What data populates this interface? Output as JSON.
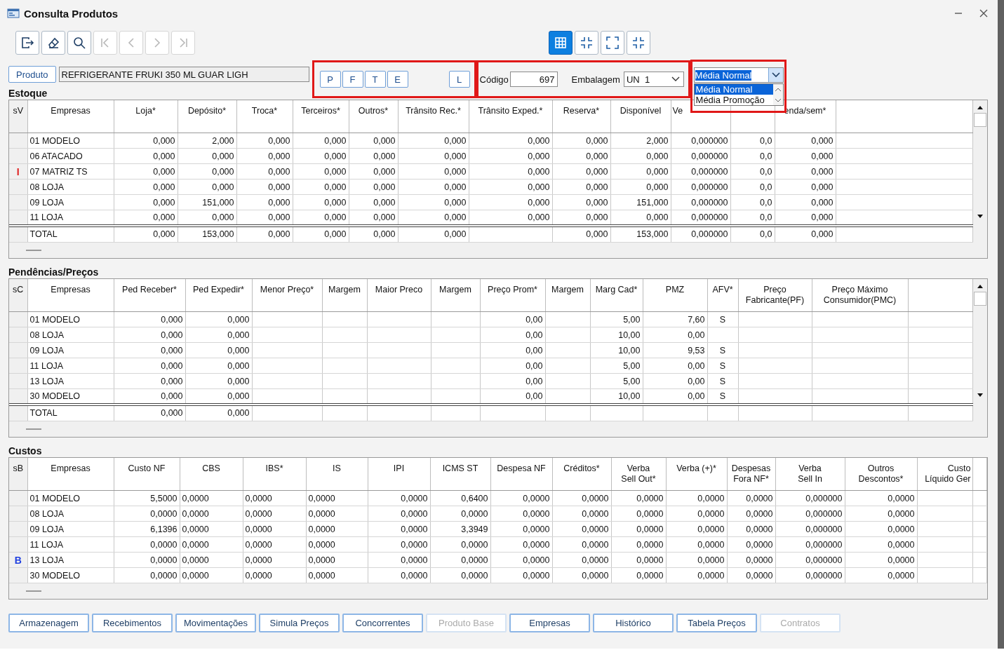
{
  "window": {
    "title": "Consulta Produtos"
  },
  "toolbar": [
    {
      "kind": "exit",
      "disabled": false
    },
    {
      "kind": "eraser",
      "disabled": false
    },
    {
      "kind": "search",
      "disabled": false
    },
    {
      "kind": "first",
      "disabled": true
    },
    {
      "kind": "prev",
      "disabled": true
    },
    {
      "kind": "next",
      "disabled": true
    },
    {
      "kind": "last",
      "disabled": true
    }
  ],
  "view_buttons": [
    {
      "kind": "grid",
      "selected": true
    },
    {
      "kind": "shrink",
      "selected": false
    },
    {
      "kind": "expand",
      "selected": false
    },
    {
      "kind": "shrink",
      "selected": false
    }
  ],
  "product": {
    "button": "Produto",
    "value": "REFRIGERANTE FRUKI 350 ML GUAR LIGH"
  },
  "filters": [
    {
      "label": "P"
    },
    {
      "label": "F"
    },
    {
      "label": "T"
    },
    {
      "label": "E"
    }
  ],
  "filter_extra": "L",
  "code": {
    "label": "Código",
    "value": "697"
  },
  "packaging": {
    "label": "Embalagem",
    "value": "UN  1"
  },
  "average": {
    "value": "Média Normal",
    "expanded": true,
    "options": [
      {
        "label": "Média Normal",
        "selected": true
      },
      {
        "label": "Média Promoção",
        "selected": false
      }
    ]
  },
  "tables": [
    {
      "title": "Estoque",
      "marker_header": "sV",
      "columns": [
        "Empresas",
        "Loja*",
        "Depósito*",
        "Troca*",
        "Terceiros*",
        "Outros*",
        "Trânsito Rec.*",
        "Trânsito Exped.*",
        "Reserva*",
        "Disponível",
        "Ve",
        "",
        "enda/sem*"
      ],
      "rows": [
        {
          "cells": [
            "01 MODELO",
            "0,000",
            "2,000",
            "0,000",
            "0,000",
            "0,000",
            "0,000",
            "0,000",
            "0,000",
            "2,000",
            "0,000000",
            "0,0",
            "0,000"
          ]
        },
        {
          "cells": [
            "06 ATACADO",
            "0,000",
            "0,000",
            "0,000",
            "0,000",
            "0,000",
            "0,000",
            "0,000",
            "0,000",
            "0,000",
            "0,000000",
            "0,0",
            "0,000"
          ]
        },
        {
          "marker": {
            "text": "I",
            "color": "#e02020"
          },
          "cells": [
            "07 MATRIZ TS",
            "0,000",
            "0,000",
            "0,000",
            "0,000",
            "0,000",
            "0,000",
            "0,000",
            "0,000",
            "0,000",
            "0,000000",
            "0,0",
            "0,000"
          ]
        },
        {
          "cells": [
            "08 LOJA",
            "0,000",
            "0,000",
            "0,000",
            "0,000",
            "0,000",
            "0,000",
            "0,000",
            "0,000",
            "0,000",
            "0,000000",
            "0,0",
            "0,000"
          ]
        },
        {
          "cells": [
            "09 LOJA",
            "0,000",
            "151,000",
            "0,000",
            "0,000",
            "0,000",
            "0,000",
            "0,000",
            "0,000",
            "151,000",
            "0,000000",
            "0,0",
            "0,000"
          ]
        },
        {
          "cells": [
            "11 LOJA",
            "0,000",
            "0,000",
            "0,000",
            "0,000",
            "0,000",
            "0,000",
            "0,000",
            "0,000",
            "0,000",
            "0,000000",
            "0,0",
            "0,000"
          ]
        }
      ],
      "total": [
        "TOTAL",
        "0,000",
        "153,000",
        "0,000",
        "0,000",
        "0,000",
        "0,000",
        {
          "empty": true
        },
        "0,000",
        "153,000",
        "0,000000",
        "0,0",
        "0,000"
      ],
      "scrollbar": true
    },
    {
      "title": "Pendências/Preços",
      "marker_header": "sC",
      "columns": [
        "Empresas",
        "Ped Receber*",
        "Ped Expedir*",
        "Menor Preço*",
        "Margem",
        "Maior Preco",
        "Margem",
        "Preço Prom*",
        "Margem",
        "Marg Cad*",
        "PMZ",
        "AFV*",
        "Preço\nFabricante(PF)",
        "Preço Máximo\nConsumidor(PMC)"
      ],
      "rows": [
        {
          "cells": [
            "01 MODELO",
            "0,000",
            "0,000",
            "",
            "",
            "",
            "",
            "0,00",
            "",
            "5,00",
            "7,60",
            "S"
          ]
        },
        {
          "cells": [
            "08 LOJA",
            "0,000",
            "0,000",
            "",
            "",
            "",
            "",
            "0,00",
            "",
            "10,00",
            "0,00"
          ]
        },
        {
          "cells": [
            "09 LOJA",
            "0,000",
            "0,000",
            "",
            "",
            "",
            "",
            "0,00",
            "",
            "10,00",
            "9,53",
            "S"
          ]
        },
        {
          "cells": [
            "11 LOJA",
            "0,000",
            "0,000",
            "",
            "",
            "",
            "",
            "0,00",
            "",
            "5,00",
            "0,00",
            "S"
          ]
        },
        {
          "cells": [
            "13 LOJA",
            "0,000",
            "0,000",
            "",
            "",
            "",
            "",
            "0,00",
            "",
            "5,00",
            "0,00",
            "S"
          ]
        },
        {
          "cells": [
            "30 MODELO",
            "0,000",
            "0,000",
            "",
            "",
            "",
            "",
            "0,00",
            "",
            "10,00",
            "0,00",
            "S"
          ]
        }
      ],
      "total": [
        "TOTAL",
        "0,000",
        "0,000"
      ],
      "scrollbar": true
    },
    {
      "title": "Custos",
      "marker_header": "sB",
      "columns": [
        "Empresas",
        "Custo NF",
        "CBS",
        "IBS*",
        "IS",
        "IPI",
        "ICMS ST",
        "Despesa NF",
        "Créditos*",
        "Verba\nSell Out*",
        "Verba (+)*",
        "Despesas\nFora NF*",
        "Verba\nSell In",
        "Outros\nDescontos*",
        "Custo\nLíquido Ger"
      ],
      "rows": [
        {
          "cells": [
            "01 MODELO",
            "5,5000",
            "0,0000",
            "0,0000",
            "0,0000",
            "0,0000",
            "0,6400",
            "0,0000",
            "0,0000",
            "0,0000",
            "0,0000",
            "0,0000",
            "0,000000",
            "0,0000"
          ]
        },
        {
          "cells": [
            "08 LOJA",
            "0,0000",
            "0,0000",
            "0,0000",
            "0,0000",
            "0,0000",
            "0,0000",
            "0,0000",
            "0,0000",
            "0,0000",
            "0,0000",
            "0,0000",
            "0,000000",
            "0,0000"
          ]
        },
        {
          "cells": [
            "09 LOJA",
            "6,1396",
            "0,0000",
            "0,0000",
            "0,0000",
            "0,0000",
            "3,3949",
            "0,0000",
            "0,0000",
            "0,0000",
            "0,0000",
            "0,0000",
            "0,000000",
            "0,0000"
          ]
        },
        {
          "cells": [
            "11 LOJA",
            "0,0000",
            "0,0000",
            "0,0000",
            "0,0000",
            "0,0000",
            "0,0000",
            "0,0000",
            "0,0000",
            "0,0000",
            "0,0000",
            "0,0000",
            "0,000000",
            "0,0000"
          ]
        },
        {
          "marker": {
            "text": "B",
            "color": "#2040e0"
          },
          "cells": [
            "13 LOJA",
            "0,0000",
            "0,0000",
            "0,0000",
            "0,0000",
            "0,0000",
            "0,0000",
            "0,0000",
            "0,0000",
            "0,0000",
            "0,0000",
            "0,0000",
            "0,000000",
            "0,0000"
          ]
        },
        {
          "cells": [
            "30 MODELO",
            "0,0000",
            "0,0000",
            "0,0000",
            "0,0000",
            "0,0000",
            "0,0000",
            "0,0000",
            "0,0000",
            "0,0000",
            "0,0000",
            "0,0000",
            "0,000000",
            "0,0000"
          ]
        }
      ],
      "scrollbar": false
    }
  ],
  "buttons": [
    {
      "label": "Armazenagem",
      "disabled": false
    },
    {
      "label": "Recebimentos",
      "disabled": false
    },
    {
      "label": "Movimentações",
      "disabled": false
    },
    {
      "label": "Simula Preços",
      "disabled": false
    },
    {
      "label": "Concorrentes",
      "disabled": false
    },
    {
      "label": "Produto Base",
      "disabled": true
    },
    {
      "label": "Empresas",
      "disabled": false
    },
    {
      "label": "Histórico",
      "disabled": false
    },
    {
      "label": "Tabela Preços",
      "disabled": false
    },
    {
      "label": "Contratos",
      "disabled": true
    }
  ]
}
